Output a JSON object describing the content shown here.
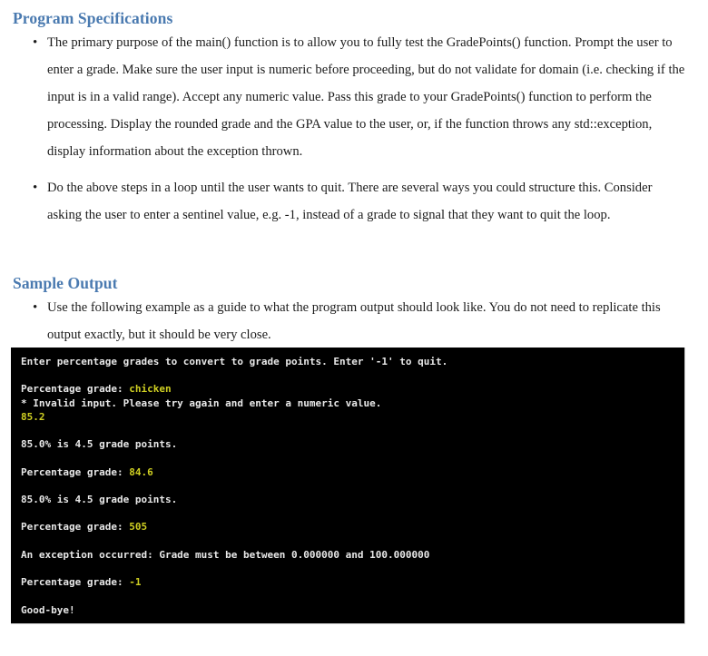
{
  "document": {
    "sections": [
      {
        "heading": "Program Specifications",
        "bullets": [
          "The primary purpose of the main() function is to allow you to fully test the GradePoints() function. Prompt the user to enter a grade. Make sure the user input is numeric before proceeding, but do not validate for domain (i.e. checking if the input is in a valid range). Accept any numeric value. Pass this grade to your GradePoints() function to perform the processing. Display the rounded grade and the GPA value to the user, or, if the function throws any std::exception, display information about the exception thrown.",
          "Do the above steps in a loop until the user wants to quit. There are several ways you could structure this. Consider asking the user to enter a sentinel value, e.g. -1, instead of a grade to signal that they want to quit the loop."
        ]
      },
      {
        "heading": "Sample Output",
        "bullets": [
          "Use the following example as a guide to what the program output should look like. You do not need to replicate this output exactly, but it should be very close."
        ]
      }
    ],
    "bullet_glyph": "•"
  },
  "terminal": {
    "background_color": "#000000",
    "text_color": "#e8e8e8",
    "input_color": "#cfcf22",
    "lines": [
      {
        "text": "Enter percentage grades to convert to grade points. Enter '-1' to quit."
      },
      {
        "text": ""
      },
      {
        "prompt": "Percentage grade: ",
        "input": "chicken"
      },
      {
        "text": "* Invalid input. Please try again and enter a numeric value."
      },
      {
        "prompt": "",
        "input": "85.2"
      },
      {
        "text": ""
      },
      {
        "text": "85.0% is 4.5 grade points."
      },
      {
        "text": ""
      },
      {
        "prompt": "Percentage grade: ",
        "input": "84.6"
      },
      {
        "text": ""
      },
      {
        "text": "85.0% is 4.5 grade points."
      },
      {
        "text": ""
      },
      {
        "prompt": "Percentage grade: ",
        "input": "505"
      },
      {
        "text": ""
      },
      {
        "text": "An exception occurred: Grade must be between 0.000000 and 100.000000"
      },
      {
        "text": ""
      },
      {
        "prompt": "Percentage grade: ",
        "input": "-1"
      },
      {
        "text": ""
      },
      {
        "text": "Good-bye!"
      }
    ]
  },
  "colors": {
    "heading": "#4a7ab0",
    "body_text": "#1c1c1c",
    "terminal_yellow": "#cfcf22"
  }
}
